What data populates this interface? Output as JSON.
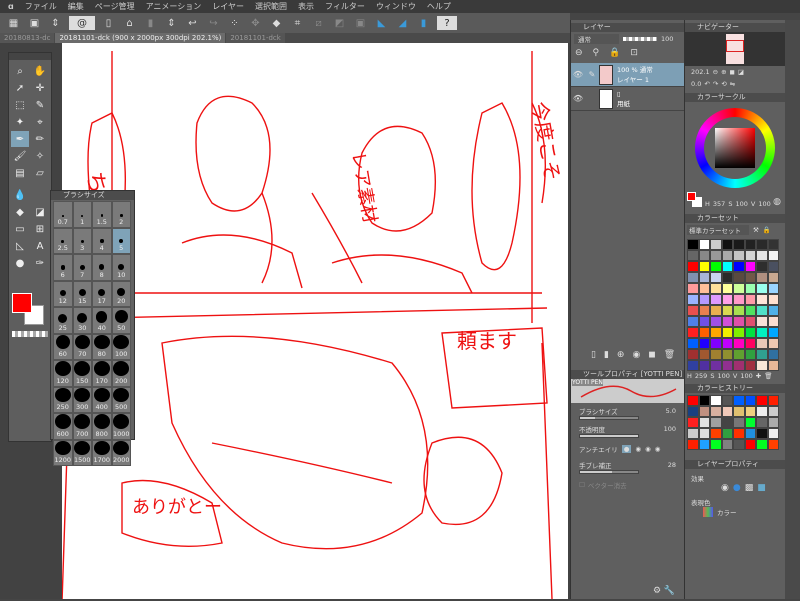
{
  "menu": [
    "ファイル",
    "編集",
    "ページ管理",
    "アニメーション",
    "レイヤー",
    "選択範囲",
    "表示",
    "フィルター",
    "ウィンドウ",
    "ヘルプ"
  ],
  "tabs": [
    {
      "label": "20180813-dc"
    },
    {
      "label": "20181101-dck (900 x 2000px 300dpi 202.1%)",
      "active": true
    },
    {
      "label": "20181101-dck"
    }
  ],
  "layer_panel": {
    "title": "レイヤー",
    "blend_mode": "通常",
    "opacity": "100",
    "layers": [
      {
        "line1": "100 % 通常",
        "line2": "レイヤー 1",
        "selected": true
      },
      {
        "line1": "",
        "line2": "用紙"
      }
    ]
  },
  "navigator": {
    "title": "ナビゲーター",
    "zoom": "202.1",
    "rotation": "0.0"
  },
  "color_circle": {
    "title": "カラーサークル",
    "h": "357",
    "s": "100",
    "v": "100",
    "main_color": "#ff0000"
  },
  "color_set": {
    "title": "カラーセット",
    "set_name": "標準カラーセット",
    "h": "259",
    "s": "100",
    "v": "100",
    "colors": [
      "#000000",
      "#ffffff",
      "#cccccc",
      "#111111",
      "#1a1a1a",
      "#222222",
      "#2a2a2a",
      "#333333",
      "#666666",
      "#888888",
      "#999999",
      "#aaaaaa",
      "#c4c4c4",
      "#d4d4d4",
      "#e4e4e4",
      "#f4f4f4",
      "#ff0000",
      "#ffff00",
      "#00ff00",
      "#00ffff",
      "#0000ff",
      "#ff00ff",
      "#2e2e2e",
      "#4a5060",
      "#8090b0",
      "#a8b4d8",
      "#c8d4f0",
      "#2a2a2a",
      "#5a4a40",
      "#705848",
      "#b09080",
      "#c8a890",
      "#ff9a9a",
      "#ffbf9a",
      "#ffdf9a",
      "#ffff9a",
      "#cfff9a",
      "#9affb0",
      "#9affef",
      "#9ad4ff",
      "#9ab4ff",
      "#b49aff",
      "#df9aff",
      "#ffa0e8",
      "#ff9ac8",
      "#ff9aa8",
      "#ffe4d8",
      "#ffe0d0",
      "#e85050",
      "#e88050",
      "#e8b050",
      "#d8d850",
      "#a8e050",
      "#50e060",
      "#50e0c8",
      "#50b0e8",
      "#5080e8",
      "#7050e8",
      "#a050e8",
      "#d050d8",
      "#e050a8",
      "#e05070",
      "#f8e0d8",
      "#fadcd0",
      "#ff2020",
      "#ff6000",
      "#ffa800",
      "#f0f000",
      "#80f000",
      "#00e040",
      "#00f0c0",
      "#00a8ff",
      "#0060ff",
      "#2000ff",
      "#8000ff",
      "#c000ff",
      "#ff00c0",
      "#ff0060",
      "#e8c8b8",
      "#f0c8b0",
      "#a03030",
      "#a05830",
      "#a08030",
      "#909030",
      "#60a030",
      "#30a040",
      "#30a090",
      "#3070a0",
      "#3040a0",
      "#5030a0",
      "#7030a0",
      "#903090",
      "#a03070",
      "#a03040",
      "#f8e8d8",
      "#e8b898"
    ]
  },
  "color_history": {
    "title": "カラーヒストリー",
    "colors": [
      "#ff0000",
      "#000000",
      "#ffffff",
      "#555555",
      "#0060ff",
      "#0050ff",
      "#ff0000",
      "#ff2000",
      "#1a4080",
      "#c09080",
      "#d8b0a0",
      "#f0c8b8",
      "#e0c070",
      "#f0d080",
      "#eeeeee",
      "#cccccc",
      "#ff2020",
      "#e0e0e0",
      "#a0a0a0",
      "#444444",
      "#777777",
      "#00ff30",
      "#666666",
      "#aaaaaa",
      "#cccccc",
      "#dddddd",
      "#ff4000",
      "#30a040",
      "#ff3000",
      "#2090e0",
      "#111111",
      "#eeeeee",
      "#ff2000",
      "#20a0ff",
      "#00ff20",
      "#808080",
      "#555555",
      "#ff0000",
      "#00ff20",
      "#ff4000"
    ]
  },
  "layer_property": {
    "title": "レイヤープロパティ",
    "effect_label": "効果",
    "expression_label": "表現色",
    "expression_value": "カラー"
  },
  "tool_property": {
    "title": "ツールプロパティ [YOTTI PEN]",
    "brush_name": "YOTTI PEN",
    "brush_size_label": "ブラシサイズ",
    "brush_size": "5.0",
    "brush_size_fraction": 0.25,
    "opacity_label": "不透明度",
    "opacity": "100",
    "opacity_fraction": 1.0,
    "antialias_label": "アンチエイリ",
    "stabilization_label": "手ブレ補正",
    "stabilization": "28",
    "stabilization_fraction": 0.55,
    "vector_label": "ベクター消去"
  },
  "brush_size_panel": {
    "title": "ブラシサイズ",
    "sizes": [
      "0.7",
      "1",
      "1.5",
      "2",
      "2.5",
      "3",
      "4",
      "5",
      "6",
      "7",
      "8",
      "10",
      "12",
      "15",
      "17",
      "20",
      "25",
      "30",
      "40",
      "50",
      "60",
      "70",
      "80",
      "100",
      "120",
      "150",
      "170",
      "200",
      "250",
      "300",
      "400",
      "500",
      "600",
      "700",
      "800",
      "1000",
      "1200",
      "1500",
      "1700",
      "2000"
    ],
    "selected": "5"
  },
  "colors": {
    "main": "#ff0000",
    "sub": "#ffffff",
    "sketch": "#ee1111"
  }
}
